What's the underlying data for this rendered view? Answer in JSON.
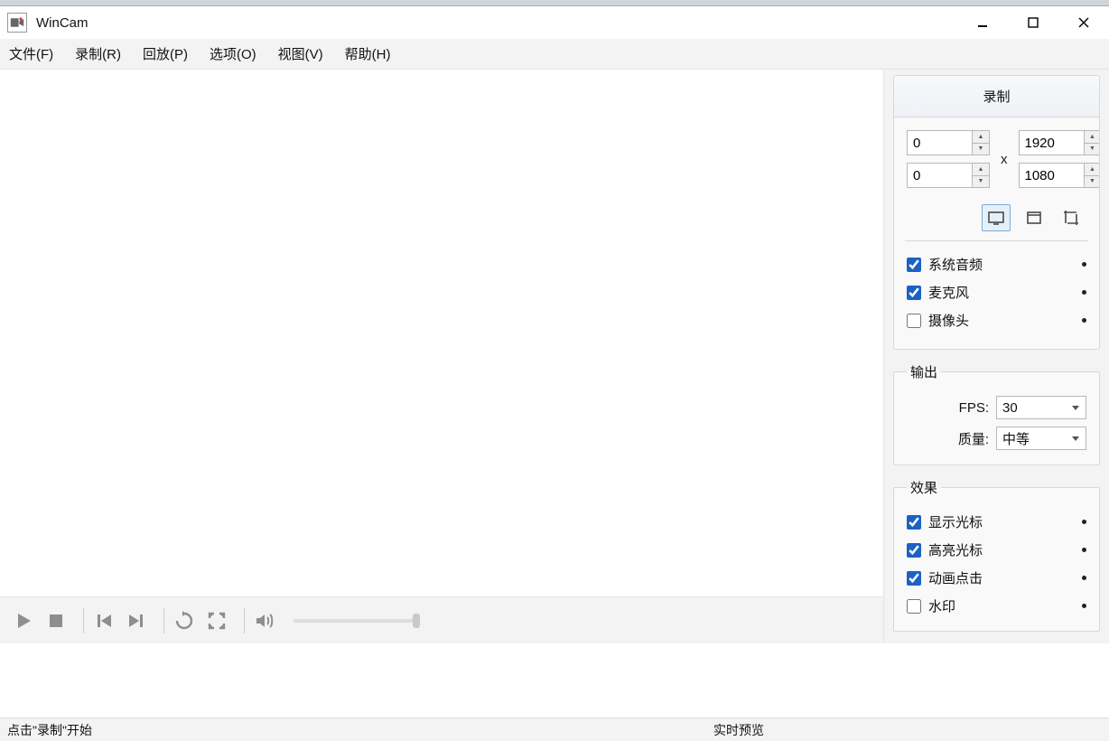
{
  "app_title": "WinCam",
  "menu": {
    "file": "文件(F)",
    "record": "录制(R)",
    "playback": "回放(P)",
    "options": "选项(O)",
    "view": "视图(V)",
    "help": "帮助(H)"
  },
  "sidebar": {
    "record_tab": "录制",
    "dimensions": {
      "x": "0",
      "y": "0",
      "separator": "x",
      "width": "1920",
      "height": "1080"
    },
    "audio": {
      "system": {
        "label": "系统音频",
        "checked": true
      },
      "mic": {
        "label": "麦克风",
        "checked": true
      },
      "camera": {
        "label": "摄像头",
        "checked": false
      }
    },
    "output": {
      "legend": "输出",
      "fps_label": "FPS:",
      "fps_value": "30",
      "quality_label": "质量:",
      "quality_value": "中等"
    },
    "effects": {
      "legend": "效果",
      "show_cursor": {
        "label": "显示光标",
        "checked": true
      },
      "highlight_cursor": {
        "label": "高亮光标",
        "checked": true
      },
      "animate_click": {
        "label": "动画点击",
        "checked": true
      },
      "watermark": {
        "label": "水印",
        "checked": false
      }
    }
  },
  "statusbar": {
    "left": "点击\"录制\"开始",
    "right": "实时预览"
  }
}
